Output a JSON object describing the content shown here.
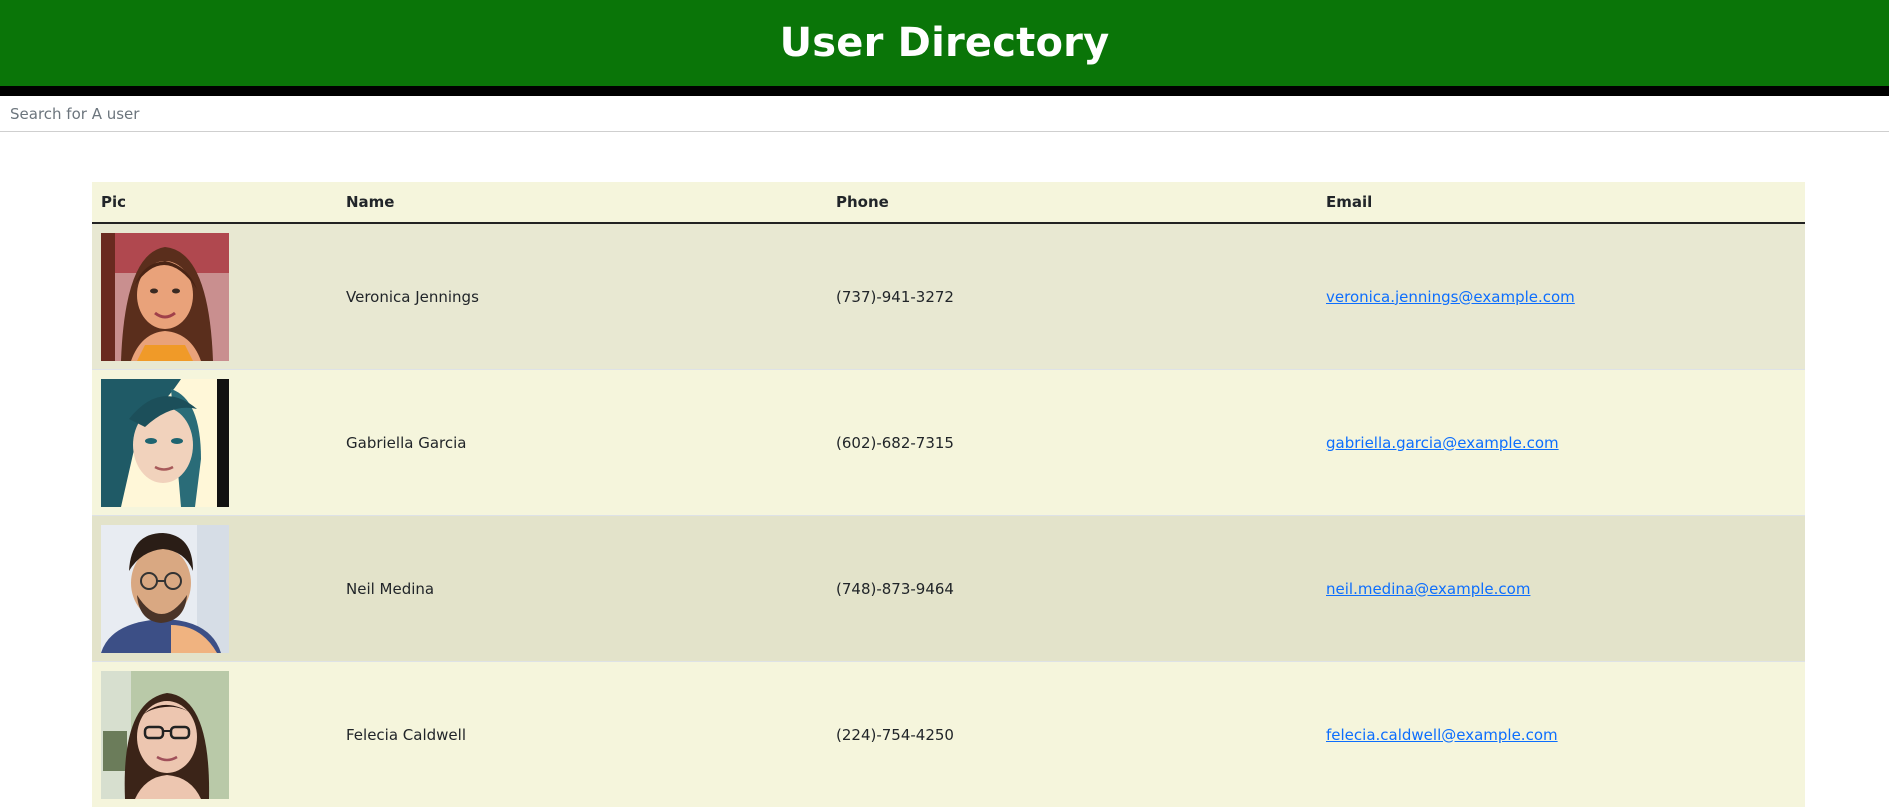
{
  "header": {
    "title": "User Directory"
  },
  "search": {
    "placeholder": "Search for A user",
    "value": ""
  },
  "table": {
    "columns": [
      "Pic",
      "Name",
      "Phone",
      "Email"
    ],
    "rows": [
      {
        "name": "Veronica Jennings",
        "phone": "(737)-941-3272",
        "email": "veronica.jennings@example.com",
        "avatar_icon": "user-photo-icon"
      },
      {
        "name": "Gabriella Garcia",
        "phone": "(602)-682-7315",
        "email": "gabriella.garcia@example.com",
        "avatar_icon": "user-photo-icon"
      },
      {
        "name": "Neil Medina",
        "phone": "(748)-873-9464",
        "email": "neil.medina@example.com",
        "avatar_icon": "user-photo-icon"
      },
      {
        "name": "Felecia Caldwell",
        "phone": "(224)-754-4250",
        "email": "felecia.caldwell@example.com",
        "avatar_icon": "user-photo-icon"
      }
    ]
  },
  "colors": {
    "header_bg": "#0a7508",
    "header_border": "#000000",
    "row_bg_light": "#f5f5dc",
    "row_bg_dark": "#e8e8d2",
    "link": "#0d6efd"
  }
}
